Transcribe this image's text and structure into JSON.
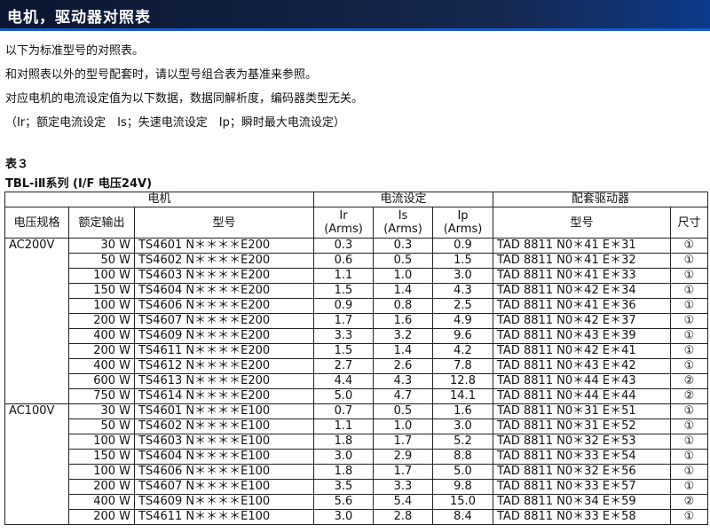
{
  "header": {
    "title": "电机，驱动器对照表"
  },
  "intro": {
    "lines": [
      "以下为标准型号的对照表。",
      "和对照表以外的型号配套时，请以型号组合表为基准来参照。",
      "对应电机的电流设定值为以下数据，数据同解析度，编码器类型无关。",
      "（Ir；额定电流设定　Is；失速电流设定　Ip；瞬时最大电流设定）"
    ]
  },
  "table_label": "表３",
  "series_label": "TBL-iⅡ系列 (I/F 电压24V)",
  "table": {
    "groups": {
      "motor": "电机",
      "current": "电流设定",
      "driver": "配套驱动器"
    },
    "columns": {
      "voltage": "电压规格",
      "power": "额定输出",
      "model": "型号",
      "ir": "Ir\n(Arms)",
      "is": "Is\n(Arms)",
      "ip": "Ip\n(Arms)",
      "driver_model": "型号",
      "size": "尺寸"
    },
    "sections": [
      {
        "voltage": "AC200V",
        "rows": [
          {
            "power": "30 W",
            "model": "TS4601 N＊＊＊＊E200",
            "ir": "0.3",
            "is": "0.3",
            "ip": "0.9",
            "driver": "TAD 8811 N0＊41 E＊31",
            "size": "①"
          },
          {
            "power": "50 W",
            "model": "TS4602 N＊＊＊＊E200",
            "ir": "0.6",
            "is": "0.5",
            "ip": "1.5",
            "driver": "TAD 8811 N0＊41 E＊32",
            "size": "①"
          },
          {
            "power": "100 W",
            "model": "TS4603 N＊＊＊＊E200",
            "ir": "1.1",
            "is": "1.0",
            "ip": "3.0",
            "driver": "TAD 8811 N0＊41 E＊33",
            "size": "①"
          },
          {
            "power": "150 W",
            "model": "TS4604 N＊＊＊＊E200",
            "ir": "1.5",
            "is": "1.4",
            "ip": "4.3",
            "driver": "TAD 8811 N0＊42 E＊34",
            "size": "①"
          },
          {
            "power": "100 W",
            "model": "TS4606 N＊＊＊＊E200",
            "ir": "0.9",
            "is": "0.8",
            "ip": "2.5",
            "driver": "TAD 8811 N0＊41 E＊36",
            "size": "①"
          },
          {
            "power": "200 W",
            "model": "TS4607 N＊＊＊＊E200",
            "ir": "1.7",
            "is": "1.6",
            "ip": "4.9",
            "driver": "TAD 8811 N0＊42 E＊37",
            "size": "①"
          },
          {
            "power": "400 W",
            "model": "TS4609 N＊＊＊＊E200",
            "ir": "3.3",
            "is": "3.2",
            "ip": "9.6",
            "driver": "TAD 8811 N0＊43 E＊39",
            "size": "①"
          },
          {
            "power": "200 W",
            "model": "TS4611 N＊＊＊＊E200",
            "ir": "1.5",
            "is": "1.4",
            "ip": "4.2",
            "driver": "TAD 8811 N0＊42 E＊41",
            "size": "①"
          },
          {
            "power": "400 W",
            "model": "TS4612 N＊＊＊＊E200",
            "ir": "2.7",
            "is": "2.6",
            "ip": "7.8",
            "driver": "TAD 8811 N0＊43 E＊42",
            "size": "①"
          },
          {
            "power": "600 W",
            "model": "TS4613 N＊＊＊＊E200",
            "ir": "4.4",
            "is": "4.3",
            "ip": "12.8",
            "driver": "TAD 8811 N0＊44 E＊43",
            "size": "②"
          },
          {
            "power": "750 W",
            "model": "TS4614 N＊＊＊＊E200",
            "ir": "5.0",
            "is": "4.7",
            "ip": "14.1",
            "driver": "TAD 8811 N0＊44 E＊44",
            "size": "②"
          }
        ]
      },
      {
        "voltage": "AC100V",
        "rows": [
          {
            "power": "30 W",
            "model": "TS4601 N＊＊＊＊E100",
            "ir": "0.7",
            "is": "0.5",
            "ip": "1.6",
            "driver": "TAD 8811 N0＊31 E＊51",
            "size": "①"
          },
          {
            "power": "50 W",
            "model": "TS4602 N＊＊＊＊E100",
            "ir": "1.1",
            "is": "1.0",
            "ip": "3.0",
            "driver": "TAD 8811 N0＊31 E＊52",
            "size": "①"
          },
          {
            "power": "100 W",
            "model": "TS4603 N＊＊＊＊E100",
            "ir": "1.8",
            "is": "1.7",
            "ip": "5.2",
            "driver": "TAD 8811 N0＊32 E＊53",
            "size": "①"
          },
          {
            "power": "150 W",
            "model": "TS4604 N＊＊＊＊E100",
            "ir": "3.0",
            "is": "2.9",
            "ip": "8.8",
            "driver": "TAD 8811 N0＊33 E＊54",
            "size": "①"
          },
          {
            "power": "100 W",
            "model": "TS4606 N＊＊＊＊E100",
            "ir": "1.8",
            "is": "1.7",
            "ip": "5.0",
            "driver": "TAD 8811 N0＊32 E＊56",
            "size": "①"
          },
          {
            "power": "200 W",
            "model": "TS4607 N＊＊＊＊E100",
            "ir": "3.5",
            "is": "3.3",
            "ip": "9.8",
            "driver": "TAD 8811 N0＊33 E＊57",
            "size": "①"
          },
          {
            "power": "400 W",
            "model": "TS4609 N＊＊＊＊E100",
            "ir": "5.6",
            "is": "5.4",
            "ip": "15.0",
            "driver": "TAD 8811 N0＊34 E＊59",
            "size": "②"
          },
          {
            "power": "200 W",
            "model": "TS4611 N＊＊＊＊E100",
            "ir": "3.0",
            "is": "2.8",
            "ip": "8.4",
            "driver": "TAD 8811 N0＊33 E＊58",
            "size": "①"
          }
        ]
      }
    ]
  }
}
